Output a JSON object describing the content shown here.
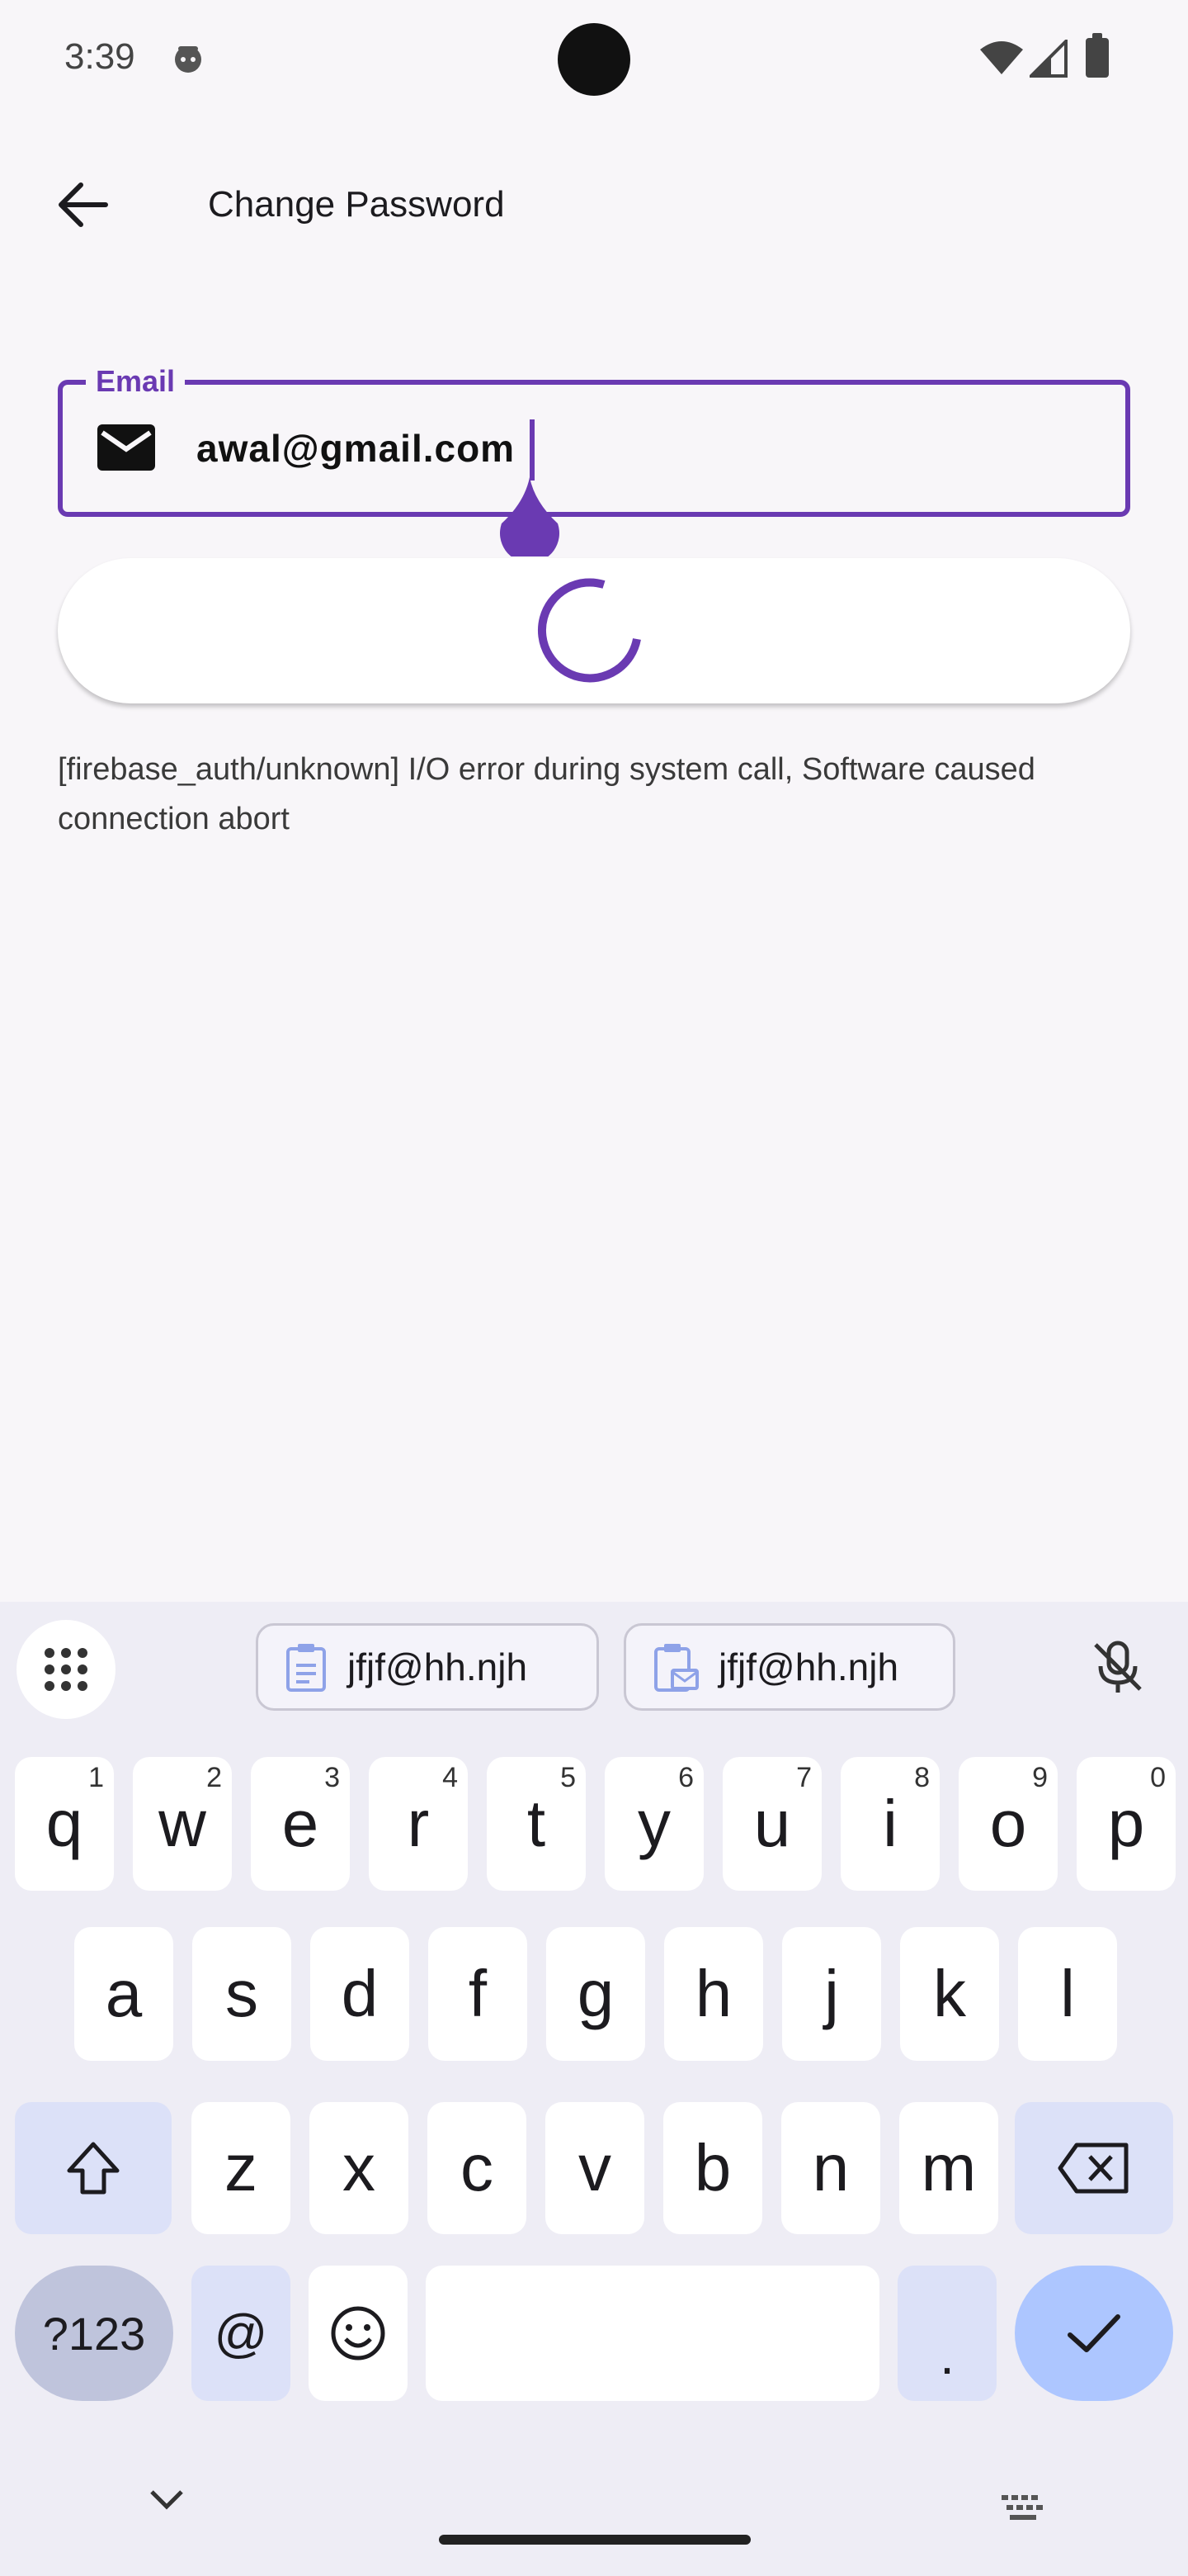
{
  "status_bar": {
    "time": "3:39"
  },
  "app_bar": {
    "title": "Change Password"
  },
  "email_field": {
    "label": "Email",
    "value": "awal@gmail.com"
  },
  "error_message": "[firebase_auth/unknown] I/O error during system call, Software caused connection abort",
  "keyboard": {
    "suggestions": [
      "jfjf@hh.njh",
      "jfjf@hh.njh"
    ],
    "row1": [
      {
        "k": "q",
        "n": "1"
      },
      {
        "k": "w",
        "n": "2"
      },
      {
        "k": "e",
        "n": "3"
      },
      {
        "k": "r",
        "n": "4"
      },
      {
        "k": "t",
        "n": "5"
      },
      {
        "k": "y",
        "n": "6"
      },
      {
        "k": "u",
        "n": "7"
      },
      {
        "k": "i",
        "n": "8"
      },
      {
        "k": "o",
        "n": "9"
      },
      {
        "k": "p",
        "n": "0"
      }
    ],
    "row2": [
      "a",
      "s",
      "d",
      "f",
      "g",
      "h",
      "j",
      "k",
      "l"
    ],
    "row3": [
      "z",
      "x",
      "c",
      "v",
      "b",
      "n",
      "m"
    ],
    "sym_label": "?123",
    "at_label": "@",
    "period_label": "."
  },
  "colors": {
    "accent": "#6a3ab2",
    "done_key": "#adc6ff",
    "modifier_key": "#dce1f8"
  }
}
